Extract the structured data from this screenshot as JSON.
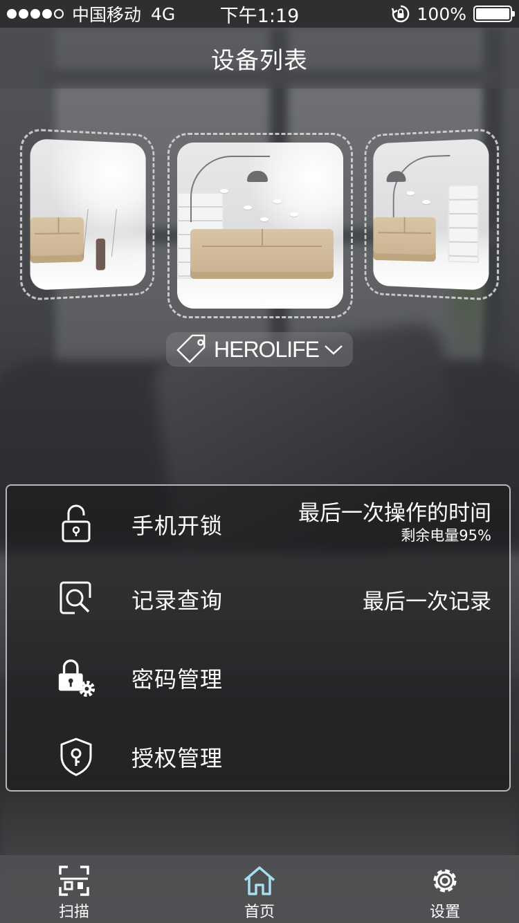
{
  "status_bar": {
    "carrier": "中国移动",
    "network": "4G",
    "time": "下午1:19",
    "battery_text": "100%",
    "battery_level": 1.0
  },
  "header": {
    "title": "设备列表"
  },
  "device_selector": {
    "name": "HEROLIFE"
  },
  "menu": {
    "unlock": {
      "label": "手机开锁",
      "info": "最后一次操作的时间",
      "sub": "剩余电量95%"
    },
    "records": {
      "label": "记录查询",
      "info": "最后一次记录"
    },
    "password": {
      "label": "密码管理"
    },
    "authorize": {
      "label": "授权管理"
    }
  },
  "tabbar": {
    "scan": "扫描",
    "home": "首页",
    "settings": "设置",
    "active": "home",
    "active_color": "#a8dcef"
  },
  "icons": [
    "signal-dots-icon",
    "rotation-lock-icon",
    "battery-icon",
    "tag-icon",
    "chevron-down-icon",
    "unlock-icon",
    "search-record-icon",
    "lock-gear-icon",
    "shield-key-icon",
    "scan-icon",
    "home-icon",
    "gear-icon"
  ]
}
